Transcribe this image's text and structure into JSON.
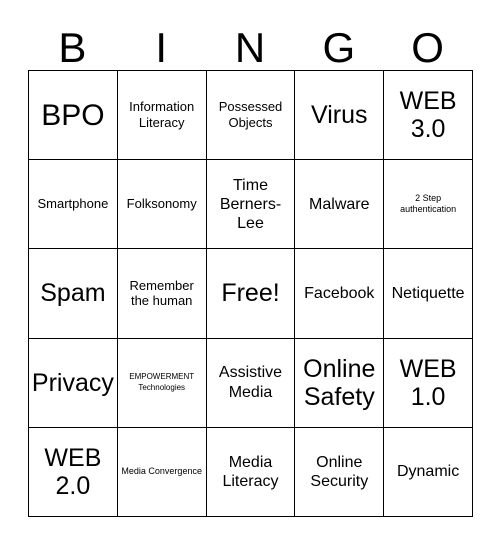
{
  "card": {
    "title": "BINGO",
    "header_letters": [
      "B",
      "I",
      "N",
      "G",
      "O"
    ],
    "columns": 5,
    "rows": 5,
    "free_space": "Free!",
    "border_color": "#000000",
    "background_color": "#ffffff",
    "text_color": "#000000",
    "cells": [
      [
        {
          "label": "BPO",
          "size": "sz-xl"
        },
        {
          "label": "Information Literacy",
          "size": "sz-sm"
        },
        {
          "label": "Possessed Objects",
          "size": "sz-sm"
        },
        {
          "label": "Virus",
          "size": "sz-lg"
        },
        {
          "label": "WEB 3.0",
          "size": "sz-lg"
        }
      ],
      [
        {
          "label": "Smartphone",
          "size": "sz-sm"
        },
        {
          "label": "Folksonomy",
          "size": "sz-sm"
        },
        {
          "label": "Time Berners-Lee",
          "size": "sz-md"
        },
        {
          "label": "Malware",
          "size": "sz-md"
        },
        {
          "label": "2 Step authentication",
          "size": "sz-xs"
        }
      ],
      [
        {
          "label": "Spam",
          "size": "sz-lg"
        },
        {
          "label": "Remember the human",
          "size": "sz-sm"
        },
        {
          "label": "Free!",
          "size": "sz-lg"
        },
        {
          "label": "Facebook",
          "size": "sz-md"
        },
        {
          "label": "Netiquette",
          "size": "sz-md"
        }
      ],
      [
        {
          "label": "Privacy",
          "size": "sz-lg"
        },
        {
          "label": "EMPOWERMENT Technologies",
          "size": "sz-xxs"
        },
        {
          "label": "Assistive Media",
          "size": "sz-md"
        },
        {
          "label": "Online Safety",
          "size": "sz-lg"
        },
        {
          "label": "WEB 1.0",
          "size": "sz-lg"
        }
      ],
      [
        {
          "label": "WEB 2.0",
          "size": "sz-lg"
        },
        {
          "label": "Media Convergence",
          "size": "sz-xs"
        },
        {
          "label": "Media Literacy",
          "size": "sz-md"
        },
        {
          "label": "Online Security",
          "size": "sz-md"
        },
        {
          "label": "Dynamic",
          "size": "sz-md"
        }
      ]
    ]
  }
}
